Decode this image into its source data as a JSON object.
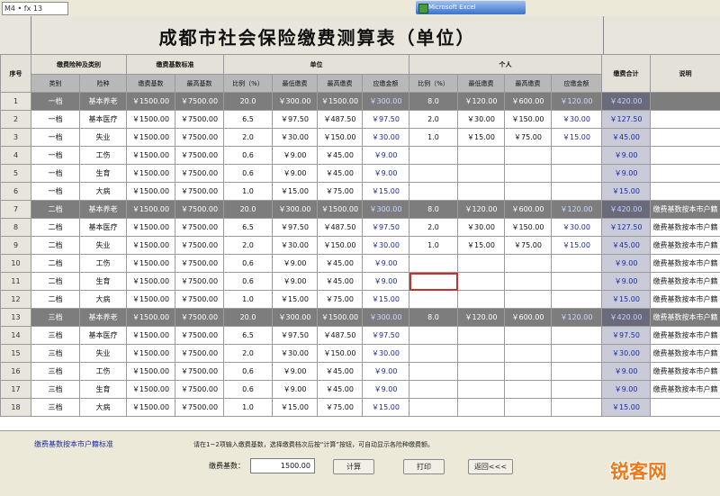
{
  "toolbar": {
    "cell_ref": "M4  •  fx  13",
    "task_label": "Microsoft Excel"
  },
  "title": "成都市社会保险缴费测算表（单位）",
  "header": {
    "top": [
      "序号",
      "缴费险种及类别",
      "缴费基数标准",
      "单位",
      "个人",
      "缴费合计",
      "说明"
    ],
    "sub": [
      "类别",
      "险种",
      "缴费基数",
      "最高基数",
      "比例（%）",
      "最低缴费",
      "最高缴费",
      "应缴金额",
      "比例（%）",
      "最低缴费",
      "最高缴费",
      "应缴金额"
    ]
  },
  "rows": [
    {
      "n": "1",
      "cat": "一档",
      "type": "基本养老",
      "b1": "￥1500.00",
      "b2": "￥7500.00",
      "p": "20.0",
      "lo": "￥300.00",
      "hi": "￥1500.00",
      "due": "￥300.00",
      "pp": "8.0",
      "plo": "￥120.00",
      "phi": "￥600.00",
      "pdue": "￥120.00",
      "sum": "￥420.00",
      "note": "",
      "dark": true
    },
    {
      "n": "2",
      "cat": "一档",
      "type": "基本医疗",
      "b1": "￥1500.00",
      "b2": "￥7500.00",
      "p": "6.5",
      "lo": "￥97.50",
      "hi": "￥487.50",
      "due": "￥97.50",
      "pp": "2.0",
      "plo": "￥30.00",
      "phi": "￥150.00",
      "pdue": "￥30.00",
      "sum": "￥127.50",
      "note": ""
    },
    {
      "n": "3",
      "cat": "一档",
      "type": "失业",
      "b1": "￥1500.00",
      "b2": "￥7500.00",
      "p": "2.0",
      "lo": "￥30.00",
      "hi": "￥150.00",
      "due": "￥30.00",
      "pp": "1.0",
      "plo": "￥15.00",
      "phi": "￥75.00",
      "pdue": "￥15.00",
      "sum": "￥45.00",
      "note": ""
    },
    {
      "n": "4",
      "cat": "一档",
      "type": "工伤",
      "b1": "￥1500.00",
      "b2": "￥7500.00",
      "p": "0.6",
      "lo": "￥9.00",
      "hi": "￥45.00",
      "due": "￥9.00",
      "pp": "",
      "plo": "",
      "phi": "",
      "pdue": "",
      "sum": "￥9.00",
      "note": ""
    },
    {
      "n": "5",
      "cat": "一档",
      "type": "生育",
      "b1": "￥1500.00",
      "b2": "￥7500.00",
      "p": "0.6",
      "lo": "￥9.00",
      "hi": "￥45.00",
      "due": "￥9.00",
      "pp": "",
      "plo": "",
      "phi": "",
      "pdue": "",
      "sum": "￥9.00",
      "note": ""
    },
    {
      "n": "6",
      "cat": "一档",
      "type": "大病",
      "b1": "￥1500.00",
      "b2": "￥7500.00",
      "p": "1.0",
      "lo": "￥15.00",
      "hi": "￥75.00",
      "due": "￥15.00",
      "pp": "",
      "plo": "",
      "phi": "",
      "pdue": "",
      "sum": "￥15.00",
      "note": ""
    },
    {
      "n": "7",
      "cat": "二档",
      "type": "基本养老",
      "b1": "￥1500.00",
      "b2": "￥7500.00",
      "p": "20.0",
      "lo": "￥300.00",
      "hi": "￥1500.00",
      "due": "￥300.00",
      "pp": "8.0",
      "plo": "￥120.00",
      "phi": "￥600.00",
      "pdue": "￥120.00",
      "sum": "￥420.00",
      "note": "缴费基数按本市户籍",
      "dark": true
    },
    {
      "n": "8",
      "cat": "二档",
      "type": "基本医疗",
      "b1": "￥1500.00",
      "b2": "￥7500.00",
      "p": "6.5",
      "lo": "￥97.50",
      "hi": "￥487.50",
      "due": "￥97.50",
      "pp": "2.0",
      "plo": "￥30.00",
      "phi": "￥150.00",
      "pdue": "￥30.00",
      "sum": "￥127.50",
      "note": "缴费基数按本市户籍"
    },
    {
      "n": "9",
      "cat": "二档",
      "type": "失业",
      "b1": "￥1500.00",
      "b2": "￥7500.00",
      "p": "2.0",
      "lo": "￥30.00",
      "hi": "￥150.00",
      "due": "￥30.00",
      "pp": "1.0",
      "plo": "￥15.00",
      "phi": "￥75.00",
      "pdue": "￥15.00",
      "sum": "￥45.00",
      "note": "缴费基数按本市户籍"
    },
    {
      "n": "10",
      "cat": "二档",
      "type": "工伤",
      "b1": "￥1500.00",
      "b2": "￥7500.00",
      "p": "0.6",
      "lo": "￥9.00",
      "hi": "￥45.00",
      "due": "￥9.00",
      "pp": "",
      "plo": "",
      "phi": "",
      "pdue": "",
      "sum": "￥9.00",
      "note": "缴费基数按本市户籍"
    },
    {
      "n": "11",
      "cat": "二档",
      "type": "生育",
      "b1": "￥1500.00",
      "b2": "￥7500.00",
      "p": "0.6",
      "lo": "￥9.00",
      "hi": "￥45.00",
      "due": "￥9.00",
      "pp": "",
      "plo": "",
      "phi": "",
      "pdue": "",
      "sum": "￥9.00",
      "note": "缴费基数按本市户籍",
      "sel": true
    },
    {
      "n": "12",
      "cat": "二档",
      "type": "大病",
      "b1": "￥1500.00",
      "b2": "￥7500.00",
      "p": "1.0",
      "lo": "￥15.00",
      "hi": "￥75.00",
      "due": "￥15.00",
      "pp": "",
      "plo": "",
      "phi": "",
      "pdue": "",
      "sum": "￥15.00",
      "note": "缴费基数按本市户籍"
    },
    {
      "n": "13",
      "cat": "三档",
      "type": "基本养老",
      "b1": "￥1500.00",
      "b2": "￥7500.00",
      "p": "20.0",
      "lo": "￥300.00",
      "hi": "￥1500.00",
      "due": "￥300.00",
      "pp": "8.0",
      "plo": "￥120.00",
      "phi": "￥600.00",
      "pdue": "￥120.00",
      "sum": "￥420.00",
      "note": "缴费基数按本市户籍",
      "dark": true
    },
    {
      "n": "14",
      "cat": "三档",
      "type": "基本医疗",
      "b1": "￥1500.00",
      "b2": "￥7500.00",
      "p": "6.5",
      "lo": "￥97.50",
      "hi": "￥487.50",
      "due": "￥97.50",
      "pp": "",
      "plo": "",
      "phi": "",
      "pdue": "",
      "sum": "￥97.50",
      "note": "缴费基数按本市户籍"
    },
    {
      "n": "15",
      "cat": "三档",
      "type": "失业",
      "b1": "￥1500.00",
      "b2": "￥7500.00",
      "p": "2.0",
      "lo": "￥30.00",
      "hi": "￥150.00",
      "due": "￥30.00",
      "pp": "",
      "plo": "",
      "phi": "",
      "pdue": "",
      "sum": "￥30.00",
      "note": "缴费基数按本市户籍"
    },
    {
      "n": "16",
      "cat": "三档",
      "type": "工伤",
      "b1": "￥1500.00",
      "b2": "￥7500.00",
      "p": "0.6",
      "lo": "￥9.00",
      "hi": "￥45.00",
      "due": "￥9.00",
      "pp": "",
      "plo": "",
      "phi": "",
      "pdue": "",
      "sum": "￥9.00",
      "note": "缴费基数按本市户籍"
    },
    {
      "n": "17",
      "cat": "三档",
      "type": "生育",
      "b1": "￥1500.00",
      "b2": "￥7500.00",
      "p": "0.6",
      "lo": "￥9.00",
      "hi": "￥45.00",
      "due": "￥9.00",
      "pp": "",
      "plo": "",
      "phi": "",
      "pdue": "",
      "sum": "￥9.00",
      "note": "缴费基数按本市户籍"
    },
    {
      "n": "18",
      "cat": "三档",
      "type": "大病",
      "b1": "￥1500.00",
      "b2": "￥7500.00",
      "p": "1.0",
      "lo": "￥15.00",
      "hi": "￥75.00",
      "due": "￥15.00",
      "pp": "",
      "plo": "",
      "phi": "",
      "pdue": "",
      "sum": "￥15.00",
      "note": ""
    }
  ],
  "bottom": {
    "link": "缴费基数按本市户籍标准",
    "hint": "请在1~2项输入缴费基数，选择缴费档次后按“计算”按钮，可自动显示各险种缴费额。",
    "input_label": "缴费基数：",
    "input_value": "1500.00",
    "btn_calc": "计算",
    "btn_print": "打印",
    "btn_back": "返回<<<"
  },
  "watermark": "锐客网"
}
